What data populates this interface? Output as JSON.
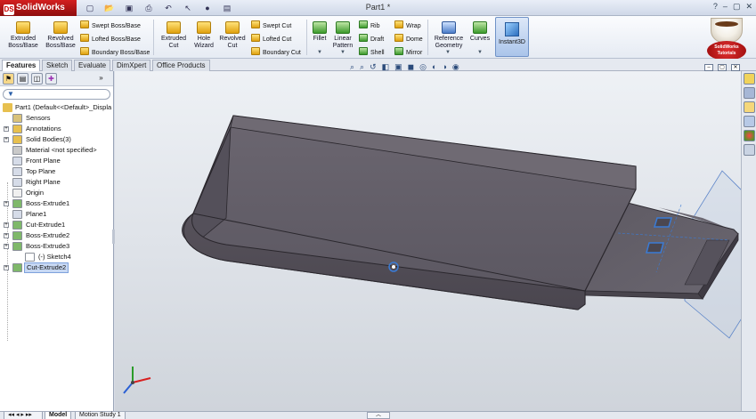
{
  "app": {
    "name": "SolidWorks",
    "logo_letters": "DS"
  },
  "window": {
    "doc_title": "Part1 *"
  },
  "quick_access": [
    "new-icon",
    "open-icon",
    "save-icon",
    "print-icon",
    "undo-icon",
    "select-icon",
    "rebuild-icon",
    "options-icon"
  ],
  "ribbon": {
    "extruded_boss": "Extruded Boss/Base",
    "revolved_boss": "Revolved Boss/Base",
    "swept_boss": "Swept Boss/Base",
    "lofted_boss": "Lofted Boss/Base",
    "boundary_boss": "Boundary Boss/Base",
    "extruded_cut": "Extruded Cut",
    "hole_wizard": "Hole Wizard",
    "revolved_cut": "Revolved Cut",
    "swept_cut": "Swept Cut",
    "lofted_cut": "Lofted Cut",
    "boundary_cut": "Boundary Cut",
    "fillet": "Fillet",
    "linear_pattern": "Linear Pattern",
    "rib": "Rib",
    "draft": "Draft",
    "shell": "Shell",
    "wrap": "Wrap",
    "dome": "Dome",
    "mirror": "Mirror",
    "reference_geometry": "Reference Geometry",
    "curves": "Curves",
    "instant3d": "Instant3D"
  },
  "tutorial_badge": "SolidWorks Tutorials",
  "tabs": [
    "Features",
    "Sketch",
    "Evaluate",
    "DimXpert",
    "Office Products"
  ],
  "active_tab": "Features",
  "feature_tree": {
    "root": "Part1  (Default<<Default>_Displa",
    "items": [
      {
        "label": "Sensors",
        "icon": "sensors-icon",
        "expandable": false
      },
      {
        "label": "Annotations",
        "icon": "annotations-icon",
        "expandable": true
      },
      {
        "label": "Solid Bodies(3)",
        "icon": "solid-bodies-icon",
        "expandable": true
      },
      {
        "label": "Material <not specified>",
        "icon": "material-icon",
        "expandable": false
      },
      {
        "label": "Front Plane",
        "icon": "plane-icon",
        "expandable": false
      },
      {
        "label": "Top Plane",
        "icon": "plane-icon",
        "expandable": false
      },
      {
        "label": "Right Plane",
        "icon": "plane-icon",
        "expandable": false
      },
      {
        "label": "Origin",
        "icon": "origin-icon",
        "expandable": false
      },
      {
        "label": "Boss-Extrude1",
        "icon": "boss-extrude-icon",
        "expandable": true
      },
      {
        "label": "Plane1",
        "icon": "plane-icon",
        "expandable": false
      },
      {
        "label": "Cut-Extrude1",
        "icon": "cut-extrude-icon",
        "expandable": true
      },
      {
        "label": "Boss-Extrude2",
        "icon": "boss-extrude-icon",
        "expandable": true
      },
      {
        "label": "Boss-Extrude3",
        "icon": "boss-extrude-icon",
        "expandable": true
      },
      {
        "label": "(-) Sketch4",
        "icon": "sketch-icon",
        "expandable": false,
        "sub": true
      },
      {
        "label": "Cut-Extrude2",
        "icon": "cut-extrude-icon",
        "expandable": true,
        "selected": true
      }
    ]
  },
  "bottom_tabs": [
    "Model",
    "Motion Study 1"
  ],
  "active_bottom_tab": "Model",
  "colors": {
    "accent": "#c8102e",
    "selection": "#c7d8f3",
    "model_body": "#5e5a63",
    "edge_highlight": "#3a7bd5"
  }
}
